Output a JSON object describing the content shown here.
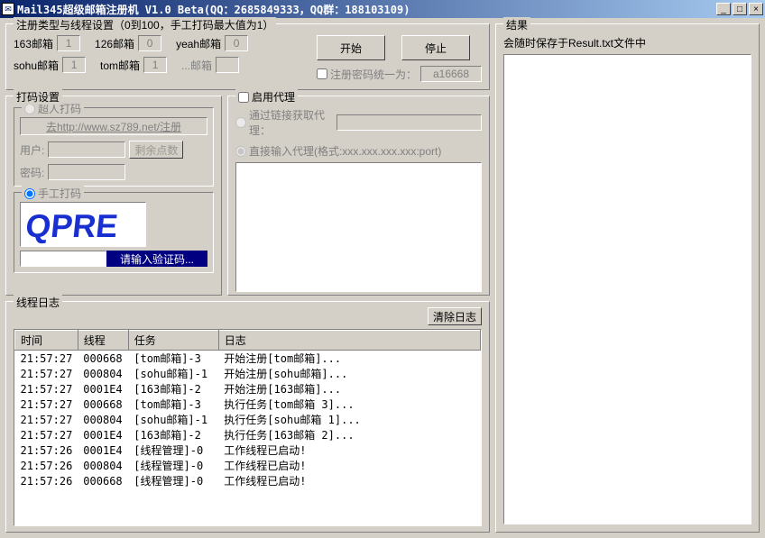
{
  "window": {
    "title": "Mail345超级邮箱注册机  V1.0 Beta(QQ：2685849333，QQ群：188103109)"
  },
  "reg": {
    "legend": "注册类型与线程设置（0到100，手工打码最大值为1）",
    "m163": "163邮箱",
    "v163": "1",
    "m126": "126邮箱",
    "v126": "0",
    "myeah": "yeah邮箱",
    "vyeah": "0",
    "msohu": "sohu邮箱",
    "vsohu": "1",
    "mtom": "tom邮箱",
    "vtom": "1",
    "mdots": "...邮箱",
    "start": "开始",
    "stop": "停止",
    "unify_label": "注册密码统一为：",
    "unify_val": "a16668"
  },
  "dama": {
    "legend": "打码设置",
    "cr": "超人打码",
    "link": "去http://www.sz789.net/注册",
    "user": "用户:",
    "pw": "密码:",
    "points": "剩余点数",
    "manual": "手工打码",
    "captcha_btn": "请输入验证码..."
  },
  "proxy": {
    "legend": "启用代理",
    "via_link": "通过链接获取代理：",
    "direct": "直接输入代理(格式:xxx.xxx.xxx.xxx:port)"
  },
  "log": {
    "legend": "线程日志",
    "clear": "清除日志",
    "cols": {
      "time": "时间",
      "thread": "线程",
      "task": "任务",
      "msg": "日志"
    },
    "rows": [
      {
        "t": "21:57:27",
        "th": "000668",
        "task": "[tom邮箱]-3",
        "msg": "开始注册[tom邮箱]..."
      },
      {
        "t": "21:57:27",
        "th": "000804",
        "task": "[sohu邮箱]-1",
        "msg": "开始注册[sohu邮箱]..."
      },
      {
        "t": "21:57:27",
        "th": "0001E4",
        "task": "[163邮箱]-2",
        "msg": "开始注册[163邮箱]..."
      },
      {
        "t": "21:57:27",
        "th": "000668",
        "task": "[tom邮箱]-3",
        "msg": "执行任务[tom邮箱 3]..."
      },
      {
        "t": "21:57:27",
        "th": "000804",
        "task": "[sohu邮箱]-1",
        "msg": "执行任务[sohu邮箱 1]..."
      },
      {
        "t": "21:57:27",
        "th": "0001E4",
        "task": "[163邮箱]-2",
        "msg": "执行任务[163邮箱 2]..."
      },
      {
        "t": "21:57:26",
        "th": "0001E4",
        "task": "[线程管理]-0",
        "msg": "工作线程已启动!"
      },
      {
        "t": "21:57:26",
        "th": "000804",
        "task": "[线程管理]-0",
        "msg": "工作线程已启动!"
      },
      {
        "t": "21:57:26",
        "th": "000668",
        "task": "[线程管理]-0",
        "msg": "工作线程已启动!"
      }
    ]
  },
  "result": {
    "legend": "结果",
    "note": "会随时保存于Result.txt文件中"
  }
}
